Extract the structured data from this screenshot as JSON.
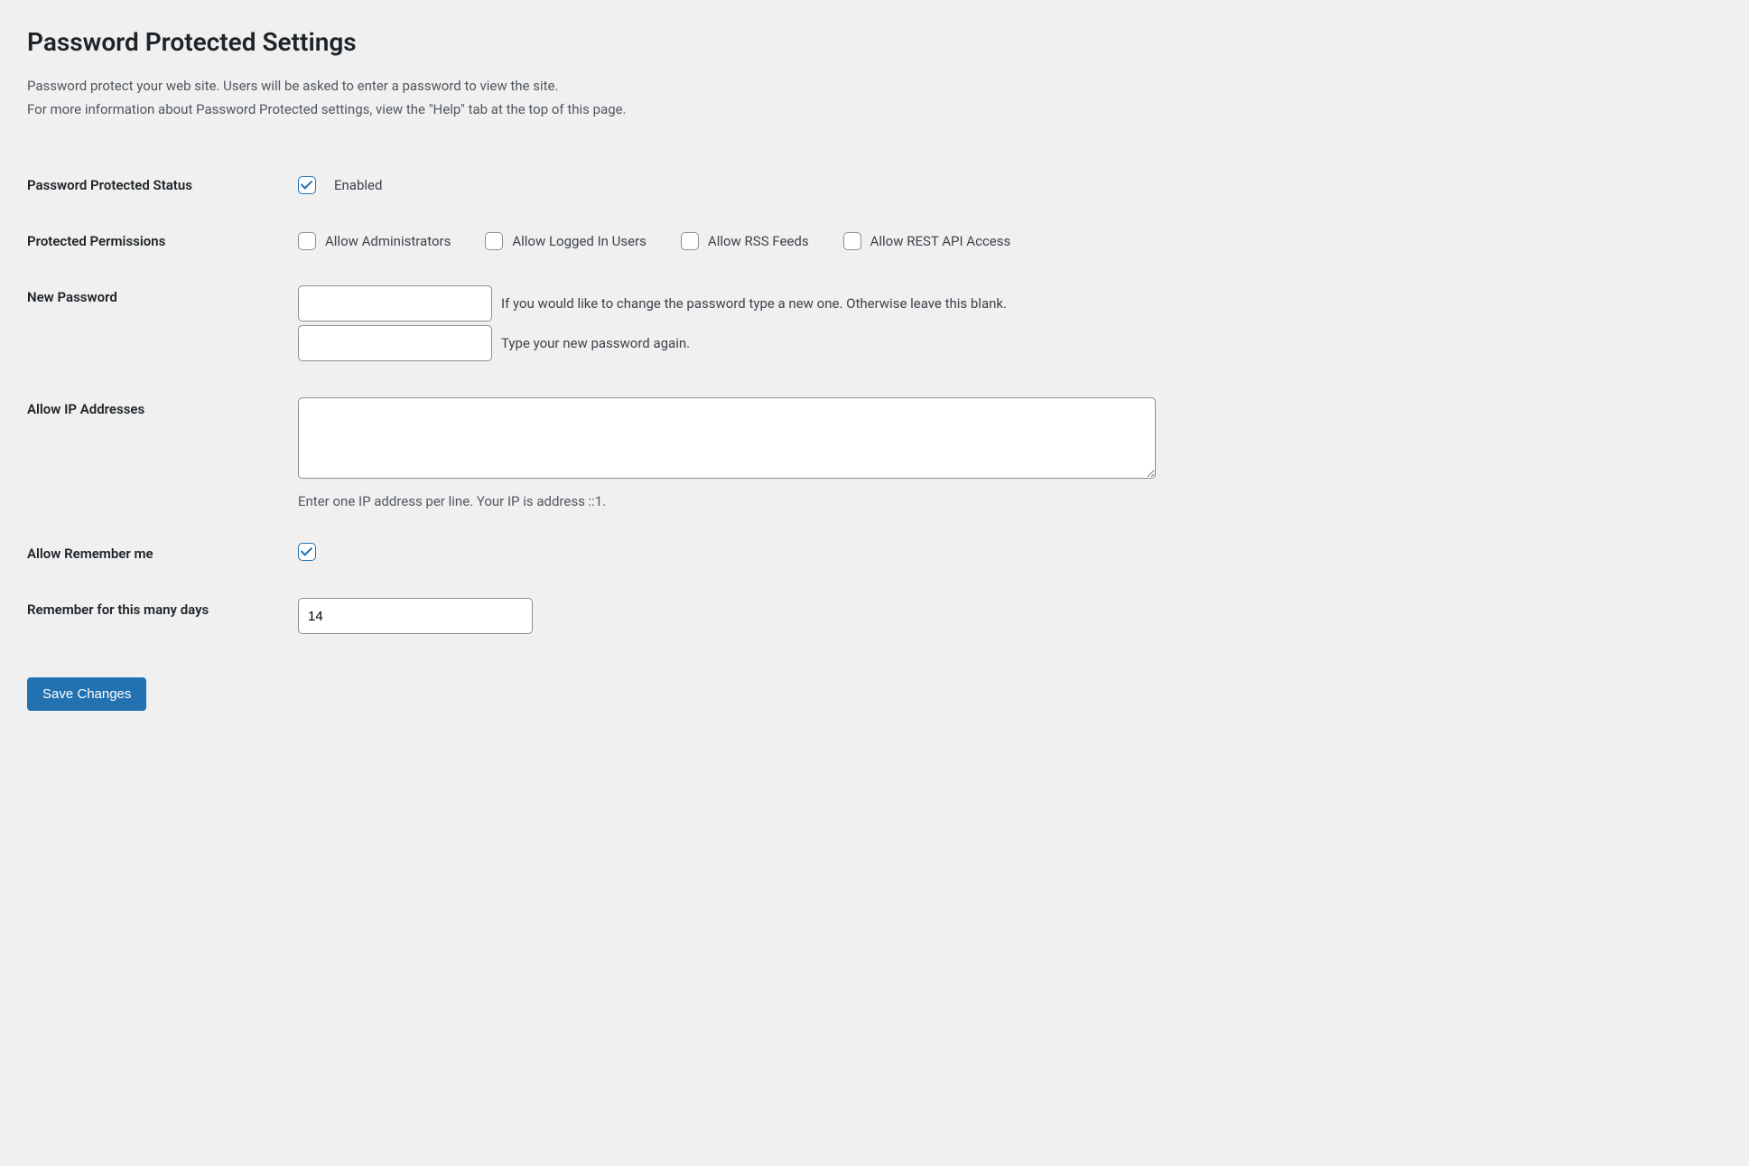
{
  "page": {
    "title": "Password Protected Settings",
    "description_line1": "Password protect your web site. Users will be asked to enter a password to view the site.",
    "description_line2": "For more information about Password Protected settings, view the \"Help\" tab at the top of this page."
  },
  "status": {
    "label": "Password Protected Status",
    "checkbox_label": "Enabled",
    "checked": true
  },
  "permissions": {
    "label": "Protected Permissions",
    "options": {
      "admins": {
        "label": "Allow Administrators",
        "checked": false
      },
      "logged_in": {
        "label": "Allow Logged In Users",
        "checked": false
      },
      "rss": {
        "label": "Allow RSS Feeds",
        "checked": false
      },
      "rest": {
        "label": "Allow REST API Access",
        "checked": false
      }
    }
  },
  "password": {
    "label": "New Password",
    "hint1": "If you would like to change the password type a new one. Otherwise leave this blank.",
    "hint2": "Type your new password again.",
    "value1": "",
    "value2": ""
  },
  "ip": {
    "label": "Allow IP Addresses",
    "value": "",
    "hint": "Enter one IP address per line. Your IP is address ::1."
  },
  "remember": {
    "label": "Allow Remember me",
    "checked": true
  },
  "remember_days": {
    "label": "Remember for this many days",
    "value": "14"
  },
  "submit": {
    "label": "Save Changes"
  }
}
